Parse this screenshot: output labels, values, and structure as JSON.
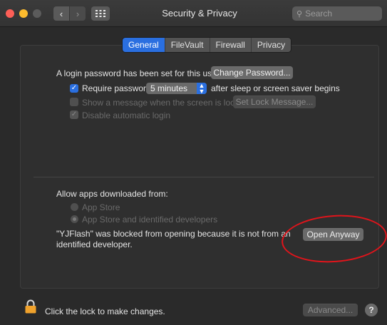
{
  "window": {
    "title": "Security & Privacy",
    "search_placeholder": "Search",
    "back_glyph": "‹",
    "forward_glyph": "›"
  },
  "tabs": [
    {
      "label": "General",
      "selected": true
    },
    {
      "label": "FileVault",
      "selected": false
    },
    {
      "label": "Firewall",
      "selected": false
    },
    {
      "label": "Privacy",
      "selected": false
    }
  ],
  "general": {
    "login_password_text": "A login password has been set for this user",
    "change_password_label": "Change Password...",
    "require_password": {
      "label": "Require password",
      "checked": true,
      "interval_value": "5 minutes",
      "suffix": "after sleep or screen saver begins"
    },
    "show_message": {
      "label": "Show a message when the screen is locked",
      "checked": false,
      "enabled": false,
      "button_label": "Set Lock Message..."
    },
    "disable_auto_login": {
      "label": "Disable automatic login",
      "checked": true,
      "enabled": false
    }
  },
  "downloads": {
    "heading": "Allow apps downloaded from:",
    "options": [
      {
        "label": "App Store",
        "selected": false
      },
      {
        "label": "App Store and identified developers",
        "selected": true
      }
    ],
    "blocked_line1": "\"YJFlash\" was blocked from opening because it is not from an",
    "blocked_line2": "identified developer.",
    "open_anyway_label": "Open Anyway",
    "highlight_color": "#e0141b"
  },
  "footer": {
    "lock_text": "Click the lock to make changes.",
    "advanced_label": "Advanced...",
    "help_label": "?"
  },
  "colors": {
    "accent": "#2a6fe0",
    "lock_icon": "#f0a22c",
    "window_bg": "#2a2a2a"
  }
}
